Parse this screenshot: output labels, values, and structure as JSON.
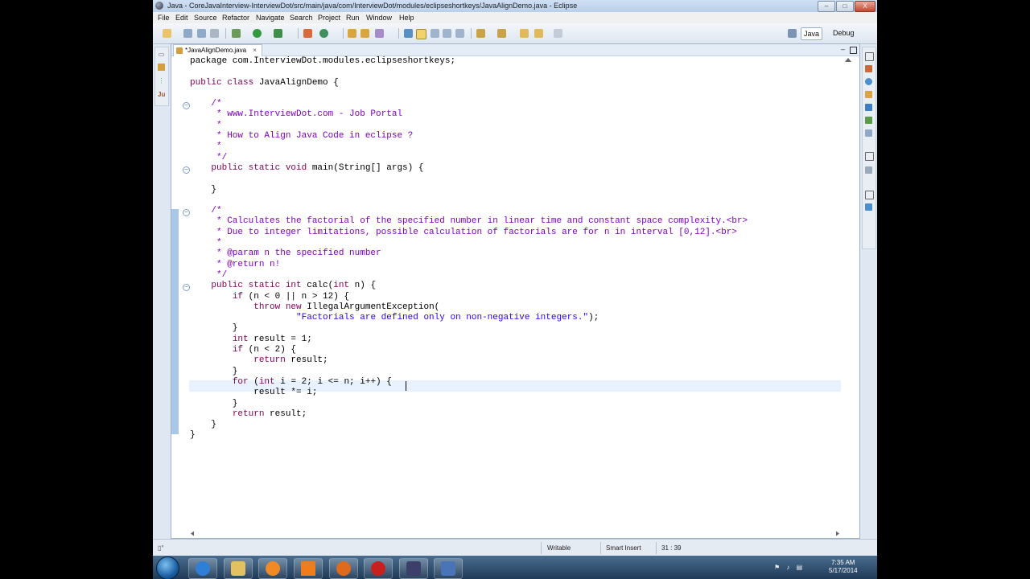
{
  "window": {
    "title": "Java - CoreJavaInterview-InterviewDot/src/main/java/com/InterviewDot/modules/eclipseshortkeys/JavaAlignDemo.java - Eclipse",
    "min": "–",
    "max": "□",
    "close": "X"
  },
  "menu": [
    "File",
    "Edit",
    "Source",
    "Refactor",
    "Navigate",
    "Search",
    "Project",
    "Run",
    "Window",
    "Help"
  ],
  "perspectives": {
    "java": "Java",
    "debug": "Debug"
  },
  "editor": {
    "tab_label": "*JavaAlignDemo.java",
    "lines": [
      [
        {
          "t": "package com.InterviewDot.modules.eclipseshortkeys;",
          "c": ""
        }
      ],
      [
        {
          "t": "",
          "c": ""
        }
      ],
      [
        {
          "t": "public class",
          "c": "kw"
        },
        {
          "t": " JavaAlignDemo {",
          "c": ""
        }
      ],
      [
        {
          "t": "",
          "c": ""
        }
      ],
      [
        {
          "t": "    /*",
          "c": "cm"
        }
      ],
      [
        {
          "t": "     * www.InterviewDot.com - Job Portal",
          "c": "cm"
        }
      ],
      [
        {
          "t": "     *",
          "c": "cm"
        }
      ],
      [
        {
          "t": "     * How to Align Java Code in eclipse ?",
          "c": "cm"
        }
      ],
      [
        {
          "t": "     *",
          "c": "cm"
        }
      ],
      [
        {
          "t": "     */",
          "c": "cm"
        }
      ],
      [
        {
          "t": "    ",
          "c": ""
        },
        {
          "t": "public static void",
          "c": "kw"
        },
        {
          "t": " main(String[] args) {",
          "c": ""
        }
      ],
      [
        {
          "t": "",
          "c": ""
        }
      ],
      [
        {
          "t": "    }",
          "c": ""
        }
      ],
      [
        {
          "t": "",
          "c": ""
        }
      ],
      [
        {
          "t": "    /*",
          "c": "cm"
        }
      ],
      [
        {
          "t": "     * Calculates the factorial of the specified number in linear time and constant space complexity.<br>",
          "c": "cm"
        }
      ],
      [
        {
          "t": "     * Due to integer limitations, possible calculation of factorials are for n in interval [0,12].<br>",
          "c": "cm"
        }
      ],
      [
        {
          "t": "     *",
          "c": "cm"
        }
      ],
      [
        {
          "t": "     * @param n the specified number",
          "c": "cm"
        }
      ],
      [
        {
          "t": "     * @return n!",
          "c": "cm"
        }
      ],
      [
        {
          "t": "     */",
          "c": "cm"
        }
      ],
      [
        {
          "t": "    ",
          "c": ""
        },
        {
          "t": "public static int",
          "c": "kw"
        },
        {
          "t": " calc(",
          "c": ""
        },
        {
          "t": "int",
          "c": "kw"
        },
        {
          "t": " n) {",
          "c": ""
        }
      ],
      [
        {
          "t": "        ",
          "c": ""
        },
        {
          "t": "if",
          "c": "kw"
        },
        {
          "t": " (n < 0 || n > 12) {",
          "c": ""
        }
      ],
      [
        {
          "t": "            ",
          "c": ""
        },
        {
          "t": "throw new",
          "c": "kw"
        },
        {
          "t": " IllegalArgumentException(",
          "c": ""
        }
      ],
      [
        {
          "t": "                    ",
          "c": ""
        },
        {
          "t": "\"Factorials are defined only on non-negative integers.\"",
          "c": "st"
        },
        {
          "t": ");",
          "c": ""
        }
      ],
      [
        {
          "t": "        }",
          "c": ""
        }
      ],
      [
        {
          "t": "        ",
          "c": ""
        },
        {
          "t": "int",
          "c": "kw"
        },
        {
          "t": " result = 1;",
          "c": ""
        }
      ],
      [
        {
          "t": "        ",
          "c": ""
        },
        {
          "t": "if",
          "c": "kw"
        },
        {
          "t": " (n < 2) {",
          "c": ""
        }
      ],
      [
        {
          "t": "            ",
          "c": ""
        },
        {
          "t": "return",
          "c": "kw"
        },
        {
          "t": " result;",
          "c": ""
        }
      ],
      [
        {
          "t": "        }",
          "c": ""
        }
      ],
      [
        {
          "t": "        ",
          "c": ""
        },
        {
          "t": "for",
          "c": "kw"
        },
        {
          "t": " (",
          "c": ""
        },
        {
          "t": "int",
          "c": "kw"
        },
        {
          "t": " i = 2; i <= n; i++) {",
          "c": ""
        }
      ],
      [
        {
          "t": "            result *= i;",
          "c": ""
        }
      ],
      [
        {
          "t": "        }",
          "c": ""
        }
      ],
      [
        {
          "t": "        ",
          "c": ""
        },
        {
          "t": "return",
          "c": "kw"
        },
        {
          "t": " result;",
          "c": ""
        }
      ],
      [
        {
          "t": "    }",
          "c": ""
        }
      ],
      [
        {
          "t": "}",
          "c": ""
        }
      ]
    ]
  },
  "status": {
    "writable": "Writable",
    "insert_mode": "Smart Insert",
    "position": "31 : 39"
  },
  "taskbar": {
    "time": "7:35 AM",
    "date": "5/17/2014"
  }
}
